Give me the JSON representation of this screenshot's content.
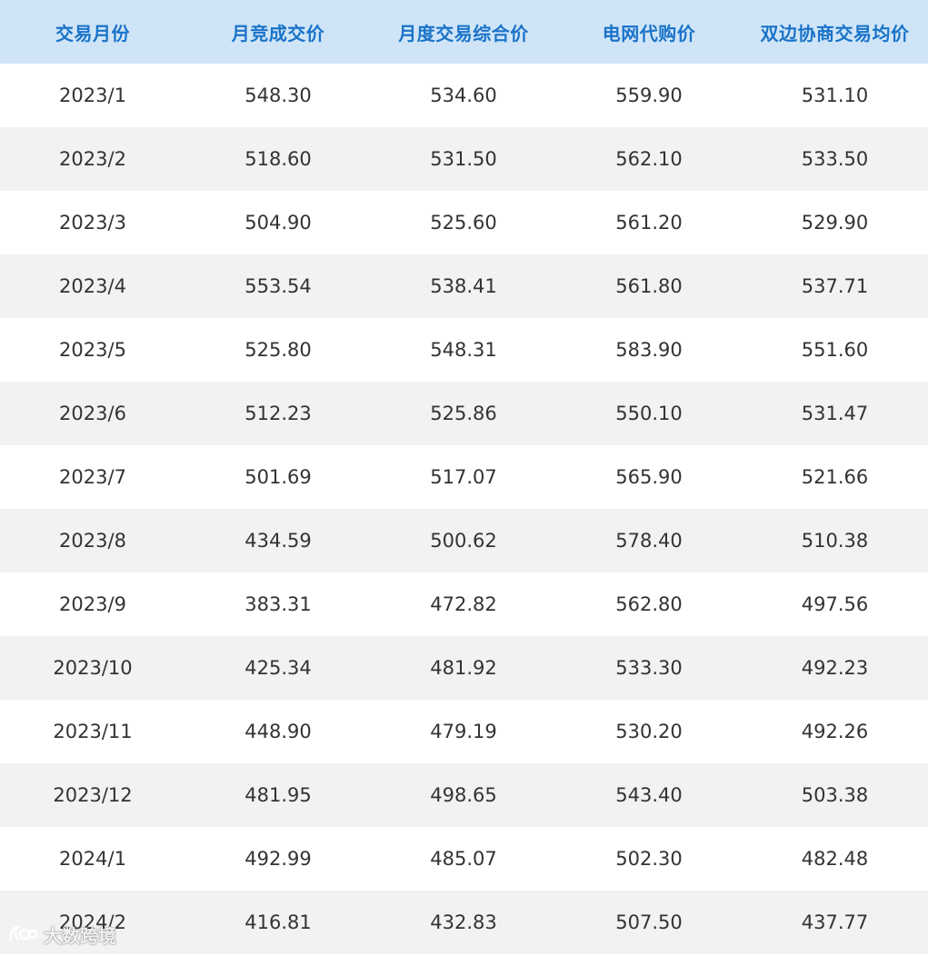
{
  "table": {
    "headers": [
      "交易月份",
      "月竞成交价",
      "月度交易综合价",
      "电网代购价",
      "双边协商交易均价"
    ],
    "rows": [
      [
        "2023/1",
        "548.30",
        "534.60",
        "559.90",
        "531.10"
      ],
      [
        "2023/2",
        "518.60",
        "531.50",
        "562.10",
        "533.50"
      ],
      [
        "2023/3",
        "504.90",
        "525.60",
        "561.20",
        "529.90"
      ],
      [
        "2023/4",
        "553.54",
        "538.41",
        "561.80",
        "537.71"
      ],
      [
        "2023/5",
        "525.80",
        "548.31",
        "583.90",
        "551.60"
      ],
      [
        "2023/6",
        "512.23",
        "525.86",
        "550.10",
        "531.47"
      ],
      [
        "2023/7",
        "501.69",
        "517.07",
        "565.90",
        "521.66"
      ],
      [
        "2023/8",
        "434.59",
        "500.62",
        "578.40",
        "510.38"
      ],
      [
        "2023/9",
        "383.31",
        "472.82",
        "562.80",
        "497.56"
      ],
      [
        "2023/10",
        "425.34",
        "481.92",
        "533.30",
        "492.23"
      ],
      [
        "2023/11",
        "448.90",
        "479.19",
        "530.20",
        "492.26"
      ],
      [
        "2023/12",
        "481.95",
        "498.65",
        "543.40",
        "503.38"
      ],
      [
        "2024/1",
        "492.99",
        "485.07",
        "502.30",
        "482.48"
      ],
      [
        "2024/2",
        "416.81",
        "432.83",
        "507.50",
        "437.77"
      ]
    ]
  },
  "watermark": {
    "text": "大数跨境",
    "icon": "watermark-logo-icon"
  },
  "colors": {
    "header_bg": "#cfe5f7",
    "header_text": "#1a73c8",
    "row_alt_bg": "#f2f2f2",
    "cell_text": "#333333"
  }
}
